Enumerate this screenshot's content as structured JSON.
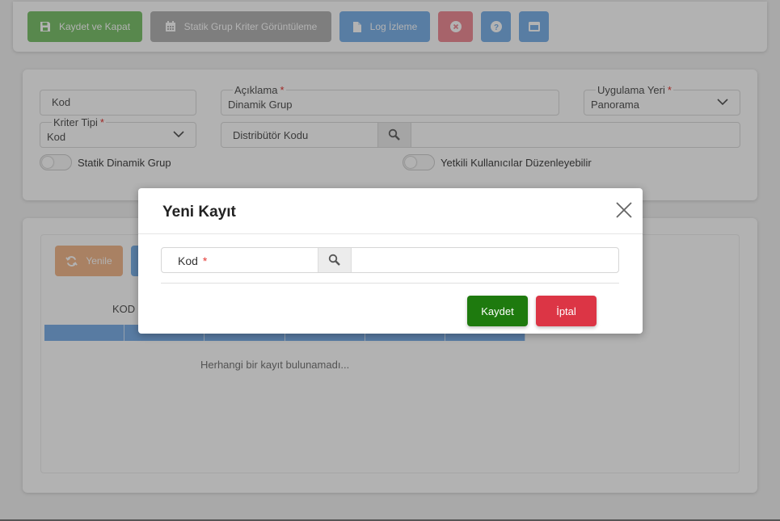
{
  "toolbar": {
    "save_close_label": "Kaydet ve Kapat",
    "static_criteria_label": "Statik Grup Kriter Görüntüleme",
    "log_label": "Log İzleme",
    "colors": {
      "green": "#7fc36f",
      "gray": "#b5b5b5",
      "blue": "#7eb3ea",
      "red": "#ef8e98"
    }
  },
  "form": {
    "code_label": "Kod",
    "description_label": "Açıklama",
    "description_value": "Dinamik Grup",
    "application_label": "Uygulama Yeri",
    "application_value": "Panorama",
    "criteria_label": "Kriter Tipi",
    "criteria_value": "Kod",
    "distributor_label": "Distribütör Kodu",
    "toggle_static_label": "Statik Dinamik Grup",
    "toggle_authorized_label": "Yetkili Kullanıcılar Düzenleyebilir",
    "required_mark": "*"
  },
  "grid": {
    "refresh_label": "Yenile",
    "column_kod": "KOD",
    "empty_message": "Herhangi bir kayıt bulunamadı..."
  },
  "modal": {
    "title": "Yeni Kayıt",
    "field_label": "Kod",
    "required_mark": "*",
    "save_label": "Kaydet",
    "cancel_label": "İptal",
    "colors": {
      "save": "#1e7a0e",
      "cancel": "#dc3545"
    }
  }
}
